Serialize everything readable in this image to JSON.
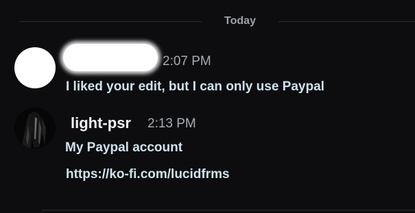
{
  "divider": {
    "label": "Today"
  },
  "messages": [
    {
      "author": "",
      "author_redacted": true,
      "avatar_color": "#ffffff",
      "time": "2:07 PM",
      "lines": [
        "I liked your edit, but I can only use Paypal"
      ]
    },
    {
      "author": "light-psr",
      "avatar_icon": "dark-figure-avatar",
      "time": "2:13 PM",
      "lines": [
        "My Paypal account",
        "https://ko-fi.com/lucidfrms"
      ]
    }
  ],
  "colors": {
    "background": "#0d0d0f",
    "message_text": "#cfe3ee",
    "username": "#f2f3f5",
    "timestamp": "#a6acb3"
  }
}
